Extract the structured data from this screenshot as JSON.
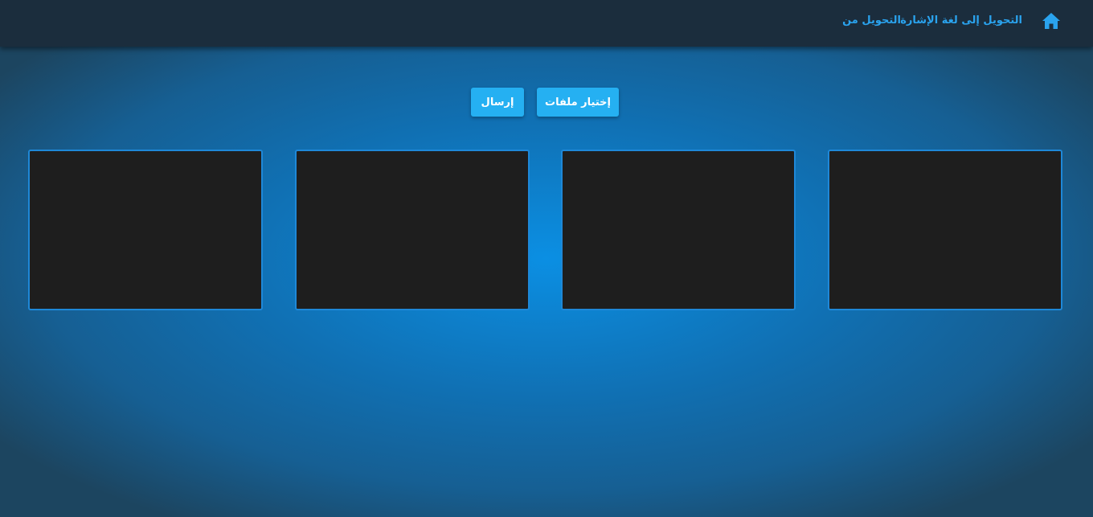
{
  "nav": {
    "home_icon": "home-icon",
    "links": [
      {
        "label": "التحويل إلى لغة الإشارة"
      },
      {
        "label": "التحويل من"
      }
    ]
  },
  "actions": {
    "choose_files_label": "إختيار ملفات",
    "send_label": "إرسال"
  },
  "panels": [
    {
      "id": "panel-1"
    },
    {
      "id": "panel-2"
    },
    {
      "id": "panel-3"
    },
    {
      "id": "panel-4"
    }
  ],
  "colors": {
    "navbar_bg": "#1b2d3d",
    "link": "#2aa3ee",
    "button_bg": "#25b0f2",
    "panel_bg": "#1e1e1e",
    "panel_border": "#1e88d8",
    "background_center": "#0b8fe3"
  }
}
